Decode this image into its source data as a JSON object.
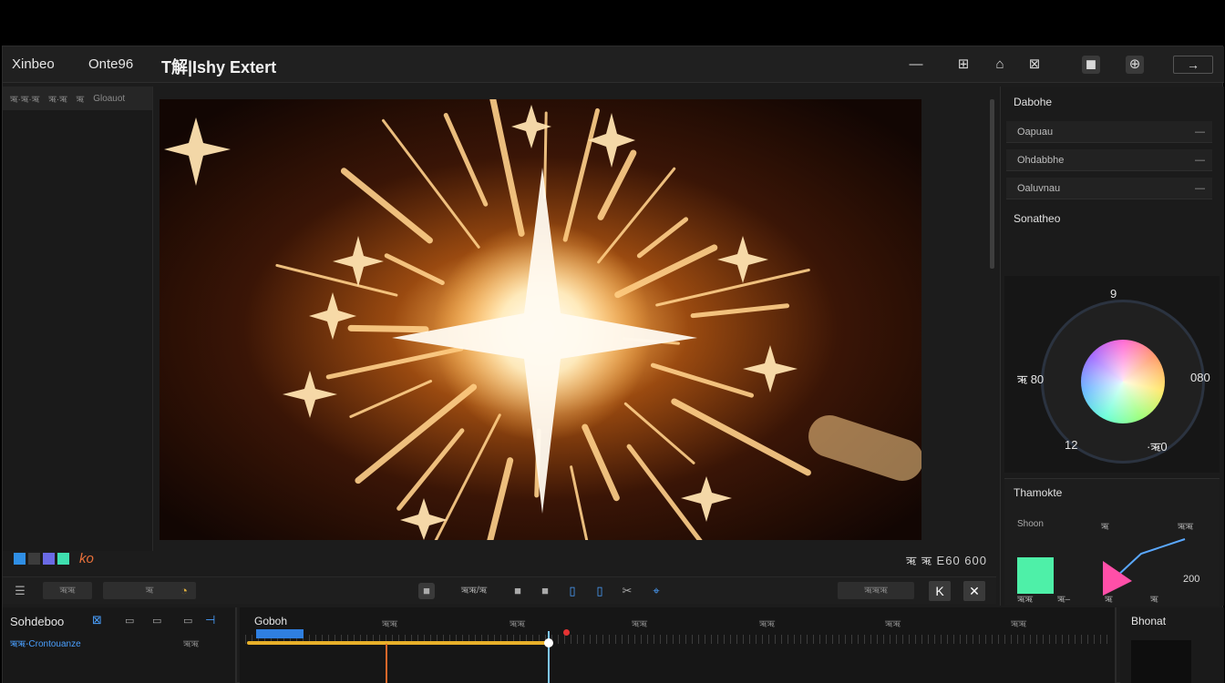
{
  "menubar": {
    "items": [
      "Xinbeo",
      "Onte96"
    ],
    "title": "T解|Ishy Extert",
    "controls": [
      "—",
      "⊞",
      "⌂",
      "⊠",
      "◼",
      "⊕"
    ],
    "back_label": "→"
  },
  "left_panel": {
    "tabs": [
      "ऋ·ऋ·ऋ",
      "ऋ·ऋ",
      "ऋ",
      "Gloauot"
    ]
  },
  "viewer_footer": {
    "label": "ko",
    "readout": "ऋ ऋ  E60  600"
  },
  "transport": {
    "field1": "ऋऋ",
    "field2": "ऋ",
    "center_label": "ऋऋ/ऋ",
    "field_right": "ऋऋऋ",
    "btn_a": "K",
    "btn_b": "✕"
  },
  "right_panel": {
    "header": "Dabohe",
    "rows": [
      "Oapuau",
      "Ohdabbhe",
      "Oaluvnau"
    ],
    "section": "Sonatheo",
    "wheel": {
      "top": "9",
      "left": "ऋ 80",
      "right": "080",
      "bottom_left": "12",
      "bottom_right": "·ऋ0"
    },
    "curve": {
      "header": "Thamokte",
      "labels": [
        "Shoon",
        "ऋ",
        "ऋऋ"
      ],
      "bottom_labels": [
        "ऋऋ",
        "ऋ–",
        "ऋ",
        "ऋ"
      ],
      "value": "200"
    }
  },
  "timeline": {
    "left_title": "Sohdeboo",
    "left_sub": "ऋऋ-Crontouanze",
    "left_small": "ऋऋ",
    "main_title": "Goboh",
    "tick_labels": [
      "ऋऋ",
      "ऋऋ",
      "ऋऋ",
      "ऋऋ",
      "ऋऋ",
      "ऋऋ",
      "ऋऋ"
    ],
    "right_title": "Bhonat"
  },
  "colors": {
    "accent_blue": "#2f7fe0",
    "accent_yellow": "#e8b02a",
    "accent_orange": "#e0682a",
    "swatch_green": "#4ef0a8",
    "swatch_pink": "#ff4fa8"
  }
}
